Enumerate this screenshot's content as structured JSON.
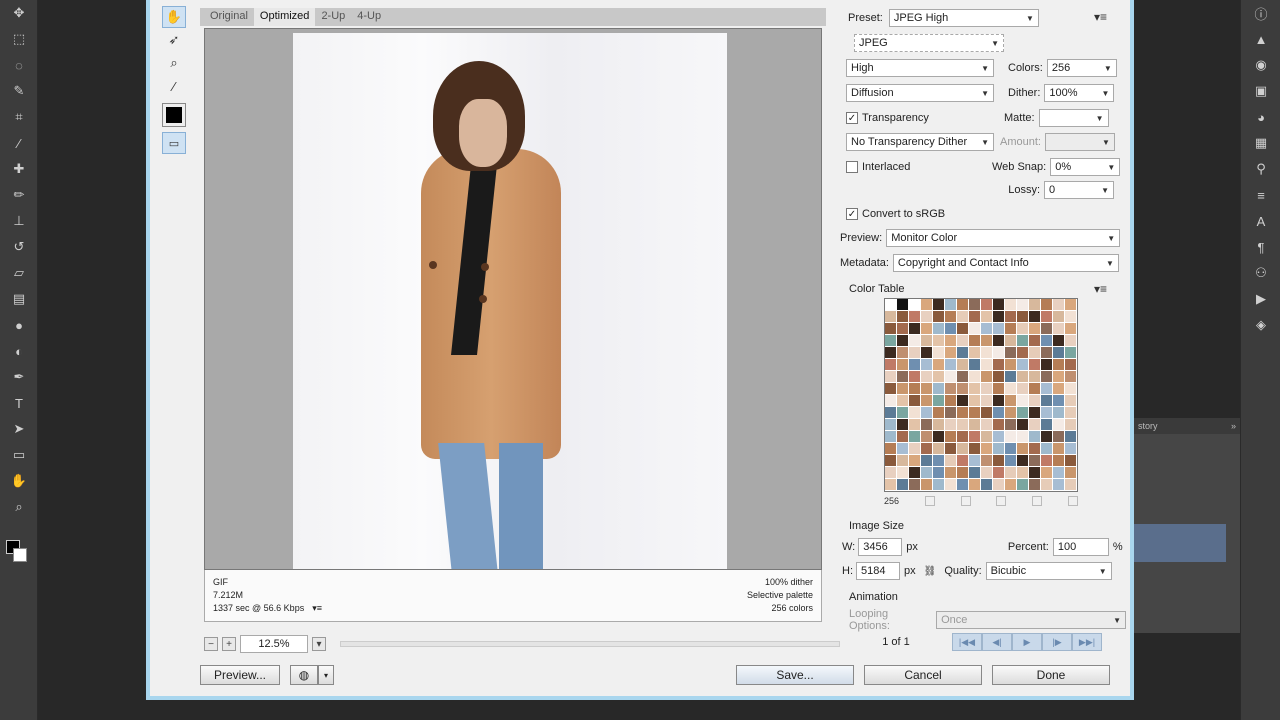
{
  "viewer": {
    "tabs": [
      "Original",
      "Optimized",
      "2-Up",
      "4-Up"
    ],
    "active_tab": "Optimized",
    "info_left": [
      "GIF",
      "7.212M",
      "1337 sec @ 56.6 Kbps"
    ],
    "info_right": [
      "100% dither",
      "Selective palette",
      "256 colors"
    ],
    "zoom": "12.5%"
  },
  "settings": {
    "preset_label": "Preset:",
    "preset_value": "JPEG High",
    "format_value": "JPEG",
    "reduction_value": "High",
    "colors_label": "Colors:",
    "colors_value": "256",
    "dither_algo_value": "Diffusion",
    "dither_label": "Dither:",
    "dither_value": "100%",
    "transparency_label": "Transparency",
    "matte_label": "Matte:",
    "matte_value": "",
    "transparency_dither_value": "No Transparency Dither",
    "amount_label": "Amount:",
    "amount_value": "",
    "interlaced_label": "Interlaced",
    "websnap_label": "Web Snap:",
    "websnap_value": "0%",
    "lossy_label": "Lossy:",
    "lossy_value": "0",
    "srgb_label": "Convert to sRGB",
    "preview_label": "Preview:",
    "preview_value": "Monitor Color",
    "metadata_label": "Metadata:",
    "metadata_value": "Copyright and Contact Info"
  },
  "color_table": {
    "title": "Color Table",
    "count": "256"
  },
  "image_size": {
    "title": "Image Size",
    "w_label": "W:",
    "w_value": "3456",
    "h_label": "H:",
    "h_value": "5184",
    "unit": "px",
    "percent_label": "Percent:",
    "percent_value": "100",
    "percent_unit": "%",
    "quality_label": "Quality:",
    "quality_value": "Bicubic"
  },
  "animation": {
    "title": "Animation",
    "looping_label": "Looping Options:",
    "looping_value": "Once",
    "frame_counter": "1 of 1"
  },
  "buttons": {
    "preview": "Preview...",
    "save": "Save...",
    "cancel": "Cancel",
    "done": "Done"
  },
  "ps_panel": {
    "tab_label": "story"
  },
  "colors": {
    "accent": "#a9d6ee",
    "selection": "#5a6e8c"
  }
}
